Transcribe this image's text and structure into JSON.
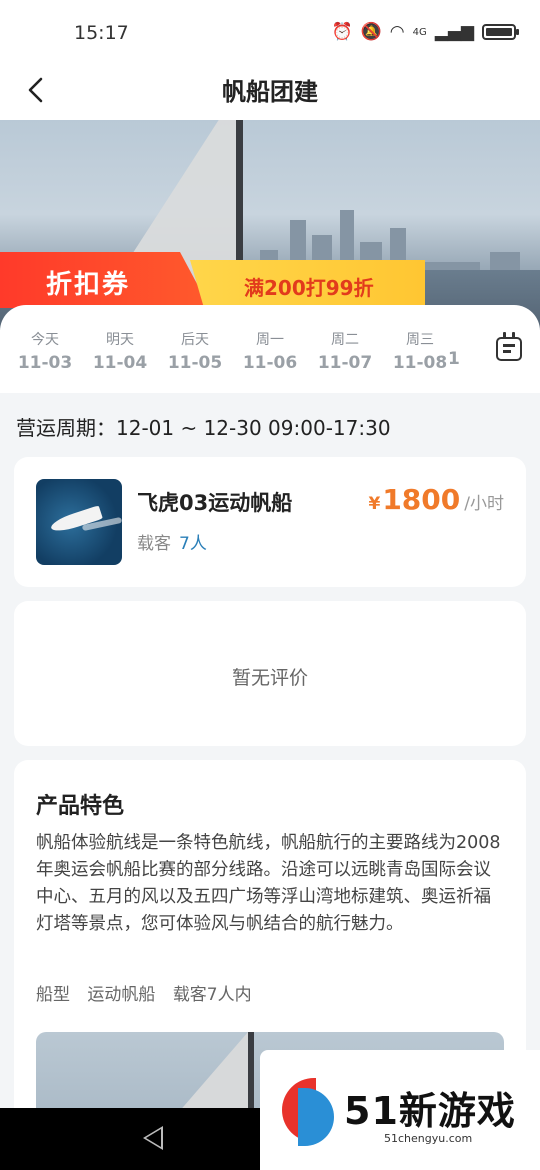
{
  "status_bar": {
    "time": "15:17",
    "network": "4G"
  },
  "nav": {
    "title": "帆船团建"
  },
  "coupon": {
    "label": "折扣券",
    "offer": "满200打99折"
  },
  "dates": [
    {
      "day": "今天",
      "date": "11-03"
    },
    {
      "day": "明天",
      "date": "11-04"
    },
    {
      "day": "后天",
      "date": "11-05"
    },
    {
      "day": "周一",
      "date": "11-06"
    },
    {
      "day": "周二",
      "date": "11-07"
    },
    {
      "day": "周三",
      "date": "11-08"
    },
    {
      "day": "",
      "date": "1"
    }
  ],
  "operation": {
    "text": "营运周期：12-01 ~ 12-30  09:00-17:30"
  },
  "boat": {
    "name": "飞虎03运动帆船",
    "capacity_label": "载客",
    "capacity_value": "7人",
    "currency": "¥",
    "price": "1800",
    "unit": "/小时"
  },
  "reviews": {
    "empty_text": "暂无评价"
  },
  "features": {
    "title": "产品特色",
    "description": "帆船体验航线是一条特色航线，帆船航行的主要路线为2008年奥运会帆船比赛的部分线路。沿途可以远眺青岛国际会议中心、五月的风以及五四广场等浮山湾地标建筑、奥运祈福灯塔等景点，您可体验风与帆结合的航行魅力。",
    "tag_type_label": "船型",
    "tag_type_value": "运动帆船",
    "tag_capacity": "载客7人内"
  },
  "watermark": {
    "brand": "51新游戏",
    "url": "51chengyu.com"
  },
  "colors": {
    "accent_orange": "#f07a2a",
    "capacity_blue": "#2a7fb8",
    "coupon_red": "#ff3a2a",
    "coupon_yellow": "#ffd64a"
  }
}
